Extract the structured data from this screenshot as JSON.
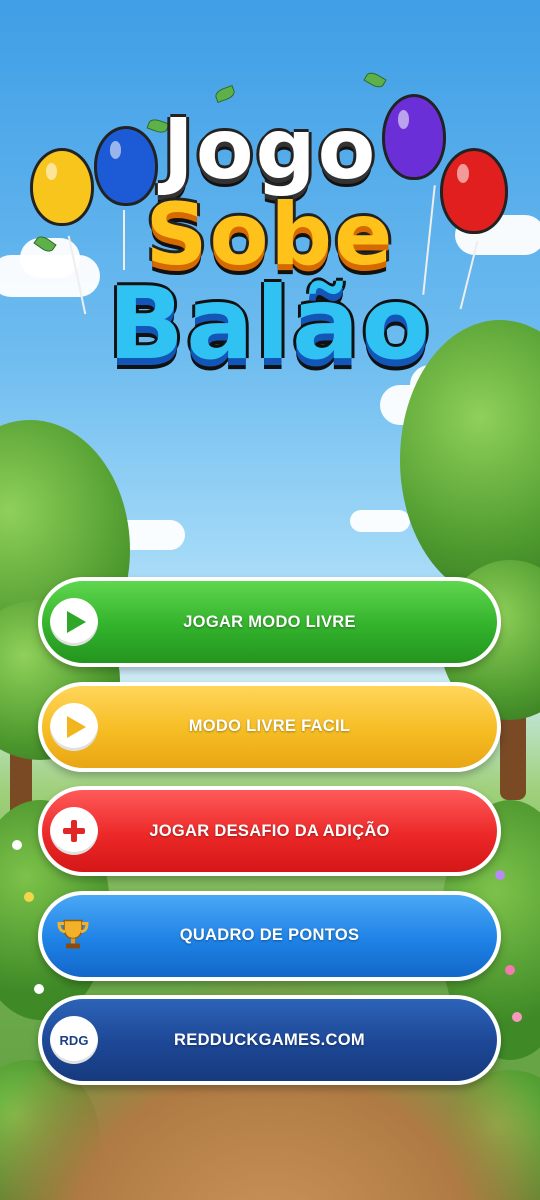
{
  "logo": {
    "line1": "Jogo",
    "line2": "Sobe",
    "line3": "Balão"
  },
  "menu": {
    "items": [
      {
        "label": "JOGAR MODO LIVRE",
        "icon": "play-icon",
        "color": "#33b22c"
      },
      {
        "label": "MODO LIVRE FACIL",
        "icon": "play-icon",
        "color": "#f6bd23"
      },
      {
        "label": "JOGAR DESAFIO DA ADIÇÃO",
        "icon": "plus-icon",
        "color": "#ec2828"
      },
      {
        "label": "QUADRO DE PONTOS",
        "icon": "trophy-icon",
        "color": "#1f82e6"
      },
      {
        "label": "REDDUCKGAMES.COM",
        "icon": "rdg-logo-icon",
        "icon_text": "RDG",
        "color": "#1d4795"
      }
    ]
  },
  "colors": {
    "sky": "#3f9ee6",
    "grass": "#6fae4c",
    "path": "#b07a44"
  }
}
